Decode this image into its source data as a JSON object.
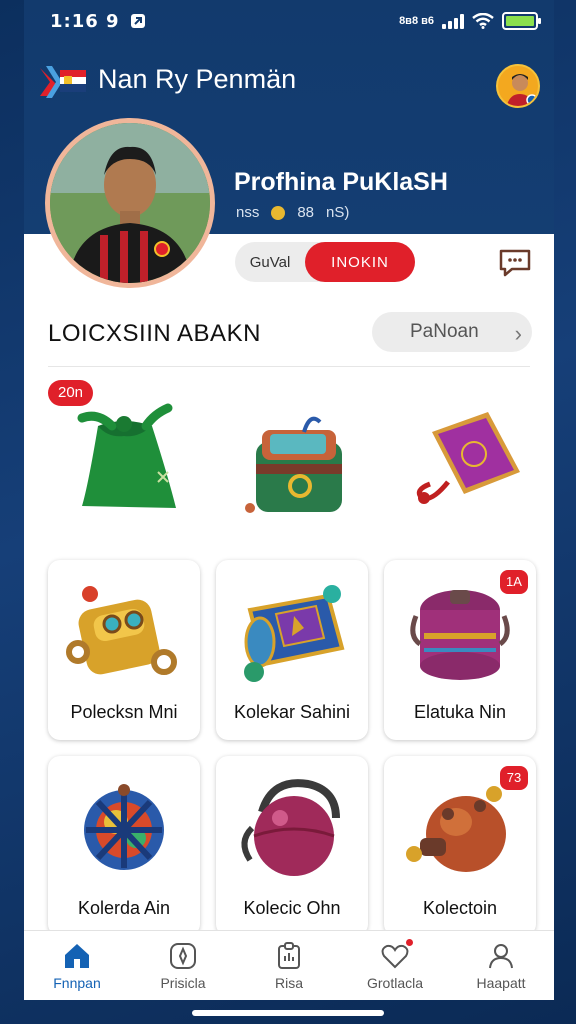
{
  "status_bar": {
    "time": "1:16 9",
    "network_label": "8ʙ8 ʙ6"
  },
  "header": {
    "app_title": "Nan Ry Penmän"
  },
  "profile": {
    "name": "Profhina PuKlaSH",
    "stat_left": "nss",
    "stat_mid": "88",
    "stat_right": "nS)"
  },
  "toggle": {
    "off_label": "GuVal",
    "on_label": "INOKIN"
  },
  "section": {
    "title": "LOICXSIIN ABAKN",
    "button_label": "PaNoan"
  },
  "new_badge": "20n",
  "top_items": [
    {
      "icon": "green-pouch-icon"
    },
    {
      "icon": "treasure-chest-icon"
    },
    {
      "icon": "purple-book-icon"
    }
  ],
  "cards": [
    {
      "label": "Polecksn Mni",
      "icon": "golden-chest-icon",
      "badge": ""
    },
    {
      "label": "Kolekar Sahini",
      "icon": "blue-scroll-icon",
      "badge": ""
    },
    {
      "label": "Elatuka Nin",
      "icon": "purple-drum-icon",
      "badge": "1A"
    },
    {
      "label": "Kolerda Ain",
      "icon": "cage-ball-icon",
      "badge": ""
    },
    {
      "label": "Kolecic Ohn",
      "icon": "maroon-ball-icon",
      "badge": ""
    },
    {
      "label": "Kolectoin",
      "icon": "orange-pot-icon",
      "badge": "73"
    }
  ],
  "nav": [
    {
      "label": "Fnnpan",
      "icon": "home-icon",
      "active": true
    },
    {
      "label": "Prisicla",
      "icon": "compass-icon",
      "active": false
    },
    {
      "label": "Risa",
      "icon": "clipboard-icon",
      "active": false
    },
    {
      "label": "Grotlacla",
      "icon": "heart-icon",
      "active": false
    },
    {
      "label": "Haapatt",
      "icon": "profile-icon",
      "active": false
    }
  ],
  "colors": {
    "accent": "#e0202a",
    "primary": "#1462b4",
    "header_bg": "#123a6d"
  }
}
